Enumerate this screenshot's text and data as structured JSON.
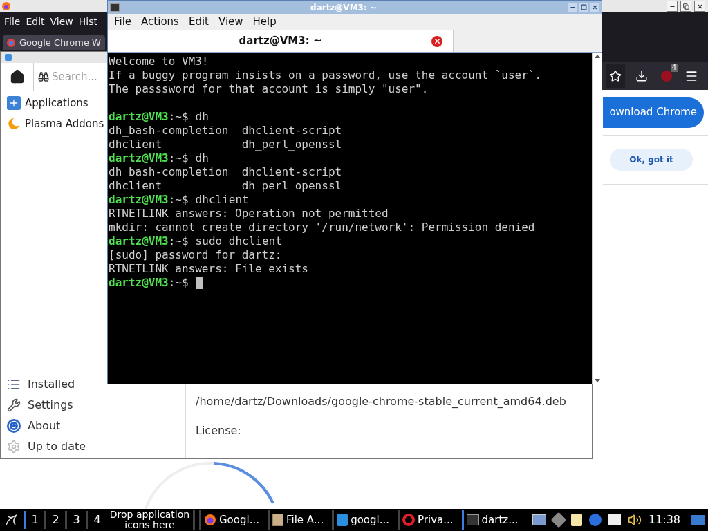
{
  "firefox": {
    "menu": [
      "File",
      "Edit",
      "View",
      "Hist"
    ],
    "tab": "Google Chrome W",
    "badge": "4",
    "download_button": "ownload Chrome",
    "ok_button": "Ok, got it"
  },
  "installer": {
    "search": {
      "placeholder": "Search..."
    },
    "categories": [
      {
        "label": "Applications",
        "kind": "apps"
      },
      {
        "label": "Plasma Addons",
        "kind": "plasma"
      }
    ],
    "nav": [
      {
        "label": "Installed",
        "kind": "list"
      },
      {
        "label": "Settings",
        "kind": "wrench"
      },
      {
        "label": "About",
        "kind": "smile"
      },
      {
        "label": "Up to date",
        "kind": "gear"
      }
    ],
    "path": "/home/dartz/Downloads/google-chrome-stable_current_amd64.deb",
    "license_label": "License:"
  },
  "terminal": {
    "title": "dartz@VM3: ~",
    "menu": [
      "File",
      "Actions",
      "Edit",
      "View",
      "Help"
    ],
    "tab": "dartz@VM3: ~",
    "lines": [
      {
        "kind": "output",
        "text": "Welcome to VM3!"
      },
      {
        "kind": "output",
        "text": "If a buggy program insists on a password, use the account `user`."
      },
      {
        "kind": "output",
        "text": "The passsword for that account is simply \"user\"."
      },
      {
        "kind": "blank"
      },
      {
        "kind": "prompt",
        "user": "dartz@VM3",
        "path": ":~$",
        "command": "dh",
        "cursor": false
      },
      {
        "kind": "output",
        "text": "dh_bash-completion  dhclient-script"
      },
      {
        "kind": "output",
        "text": "dhclient            dh_perl_openssl"
      },
      {
        "kind": "prompt",
        "user": "dartz@VM3",
        "path": ":~$",
        "command": "dh",
        "cursor": false
      },
      {
        "kind": "output",
        "text": "dh_bash-completion  dhclient-script"
      },
      {
        "kind": "output",
        "text": "dhclient            dh_perl_openssl"
      },
      {
        "kind": "prompt",
        "user": "dartz@VM3",
        "path": ":~$",
        "command": "dhclient",
        "cursor": false
      },
      {
        "kind": "output",
        "text": "RTNETLINK answers: Operation not permitted"
      },
      {
        "kind": "output",
        "text": "mkdir: cannot create directory '/run/network': Permission denied"
      },
      {
        "kind": "prompt",
        "user": "dartz@VM3",
        "path": ":~$",
        "command": "sudo dhclient",
        "cursor": false
      },
      {
        "kind": "output",
        "text": "[sudo] password for dartz:"
      },
      {
        "kind": "output",
        "text": "RTNETLINK answers: File exists"
      },
      {
        "kind": "prompt",
        "user": "dartz@VM3",
        "path": ":~$",
        "cursor": true
      }
    ]
  },
  "taskbar": {
    "workspaces": [
      {
        "label": "1",
        "selected": true
      },
      {
        "label": "2",
        "selected": false
      },
      {
        "label": "3",
        "selected": false
      },
      {
        "label": "4",
        "selected": false
      }
    ],
    "drop_hint": "Drop application icons here",
    "tasks": [
      {
        "label": "Googl...",
        "kind": "firefox",
        "selected": false
      },
      {
        "label": "File A...",
        "kind": "archive",
        "selected": false
      },
      {
        "label": "googl...",
        "kind": "store",
        "selected": false
      },
      {
        "label": "Priva...",
        "kind": "opera",
        "selected": false
      },
      {
        "label": "dartz...",
        "kind": "terminal",
        "selected": true
      }
    ],
    "clock": "11:38"
  }
}
